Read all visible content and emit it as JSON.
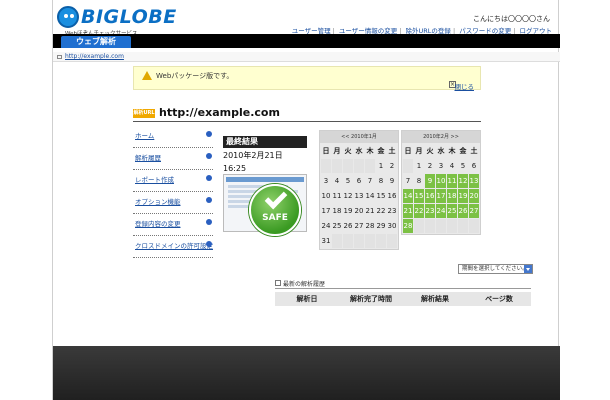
{
  "header": {
    "logo_text": "BIGLOBE",
    "logo_sub": "Webほぞんチェックサービス",
    "greeting": "こんにちは〇〇〇〇さん",
    "links": [
      "ユーザー管理",
      "ユーザー情報の変更",
      "除外URLの登録",
      "パスワードの変更",
      "ログアウト"
    ]
  },
  "nav": {
    "active_tab": "ウェブ解析"
  },
  "breadcrumb": {
    "url": "http://example.com"
  },
  "notice": {
    "text": "Webパッケージ版です。",
    "close_label": "閉じる",
    "close_icon_glyph": "×"
  },
  "url_title": {
    "badge": "解析URL",
    "url": "http://example.com"
  },
  "sidebar": {
    "items": [
      {
        "label": "ホーム"
      },
      {
        "label": "解析履歴"
      },
      {
        "label": "レポート作成"
      },
      {
        "label": "オプション機能"
      },
      {
        "label": "登録内容の変更"
      },
      {
        "label": "クロスドメインの許可設定"
      }
    ]
  },
  "result": {
    "title": "最終結果",
    "date": "2010年2月21日",
    "time": "16:25",
    "status": "SAFE"
  },
  "calendar_jan": {
    "header": "<< 2010年1月",
    "dow": [
      "日",
      "月",
      "火",
      "水",
      "木",
      "金",
      "土"
    ],
    "cells": [
      "",
      "",
      "",
      "",
      "",
      "1",
      "2",
      "3",
      "4",
      "5",
      "6",
      "7",
      "8",
      "9",
      "10",
      "11",
      "12",
      "13",
      "14",
      "15",
      "16",
      "17",
      "18",
      "19",
      "20",
      "21",
      "22",
      "23",
      "24",
      "25",
      "26",
      "27",
      "28",
      "29",
      "30",
      "31",
      "",
      "",
      "",
      "",
      "",
      ""
    ],
    "green": []
  },
  "calendar_feb": {
    "header": "2010年2月 >>",
    "dow": [
      "日",
      "月",
      "火",
      "水",
      "木",
      "金",
      "土"
    ],
    "cells": [
      "",
      "1",
      "2",
      "3",
      "4",
      "5",
      "6",
      "7",
      "8",
      "9",
      "10",
      "11",
      "12",
      "13",
      "14",
      "15",
      "16",
      "17",
      "18",
      "19",
      "20",
      "21",
      "22",
      "23",
      "24",
      "25",
      "26",
      "27",
      "28",
      "",
      "",
      "",
      "",
      "",
      ""
    ],
    "green": [
      "9",
      "10",
      "11",
      "12",
      "13",
      "14",
      "15",
      "16",
      "17",
      "18",
      "19",
      "20",
      "21",
      "22",
      "23",
      "24",
      "25",
      "26",
      "27",
      "28"
    ]
  },
  "period_select": {
    "value": "期間を選択してください。"
  },
  "history": {
    "title": "最新の解析履歴",
    "columns": [
      "解析日",
      "解析完了時間",
      "解析結果",
      "ページ数"
    ]
  }
}
